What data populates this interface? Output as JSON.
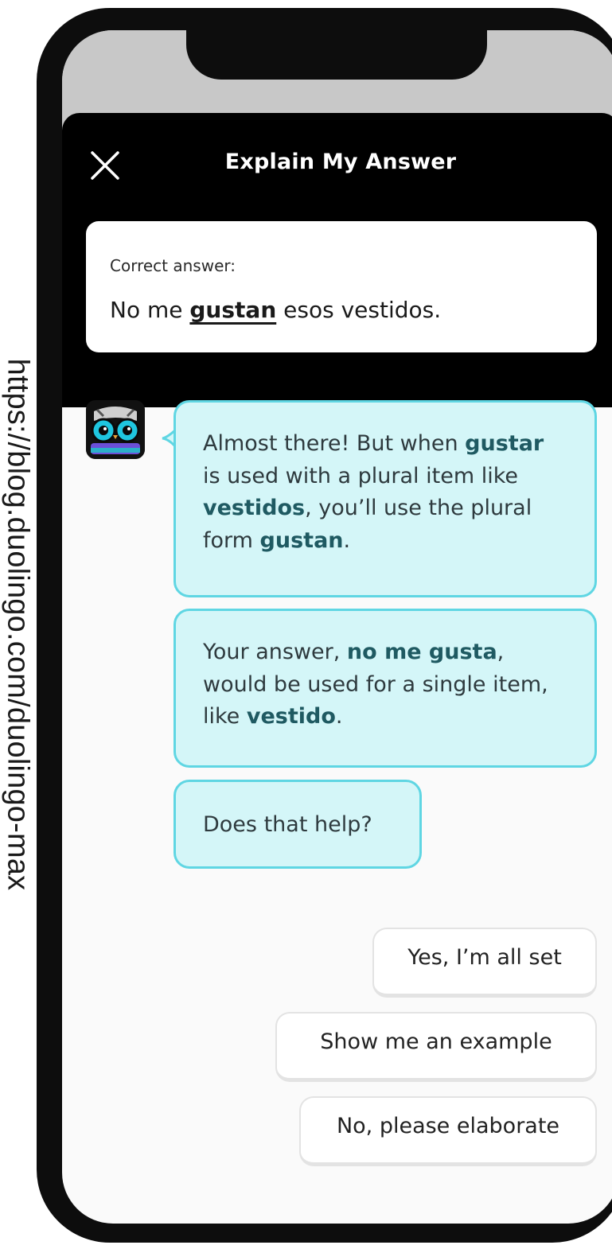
{
  "source_url": "https://blog.duolingo.com/duolingo-max",
  "header": {
    "title": "Explain My Answer",
    "close_icon": "close-icon"
  },
  "correct_answer": {
    "label": "Correct answer:",
    "prefix": "No me ",
    "highlight": "gustan",
    "suffix": " esos vestidos."
  },
  "avatar": {
    "icon": "owl-avatar-icon"
  },
  "messages": [
    {
      "parts": [
        {
          "text": "Almost there! But when ",
          "bold": false
        },
        {
          "text": "gustar",
          "bold": true
        },
        {
          "text": " is used with a plural item like ",
          "bold": false
        },
        {
          "text": "vestidos",
          "bold": true
        },
        {
          "text": ", you’ll use the plural form ",
          "bold": false
        },
        {
          "text": "gustan",
          "bold": true
        },
        {
          "text": ".",
          "bold": false
        }
      ]
    },
    {
      "parts": [
        {
          "text": "Your answer, ",
          "bold": false
        },
        {
          "text": "no me gusta",
          "bold": true
        },
        {
          "text": ", would be used for a single item, like ",
          "bold": false
        },
        {
          "text": "vestido",
          "bold": true
        },
        {
          "text": ".",
          "bold": false
        }
      ]
    },
    {
      "parts": [
        {
          "text": "Does that help?",
          "bold": false
        }
      ]
    }
  ],
  "quick_replies": {
    "yes": "Yes, I’m all set",
    "example": "Show me an example",
    "elaborate": "No, please elaborate"
  },
  "colors": {
    "bubble_bg": "#d4f6f8",
    "bubble_border": "#5fd6e3",
    "header_bg": "#000000",
    "bold_text": "#1f5a62"
  }
}
